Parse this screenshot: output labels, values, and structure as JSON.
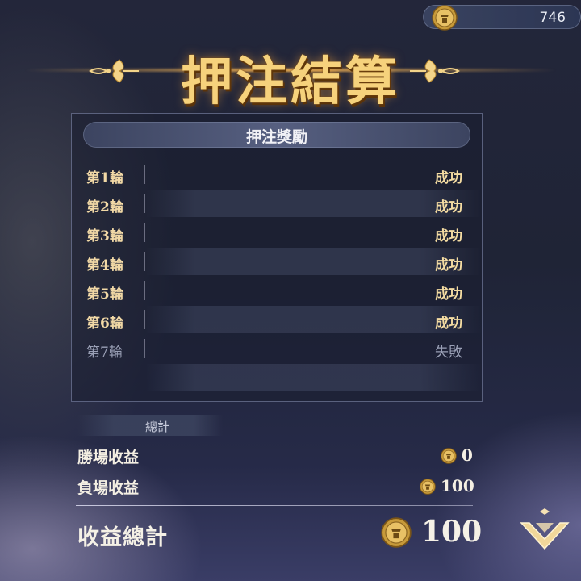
{
  "currency": {
    "amount": "746",
    "icon": "gold-coin-icon"
  },
  "title": "押注結算",
  "rewards": {
    "header": "押注獎勵",
    "rounds": [
      {
        "name": "第1輪",
        "result": "成功"
      },
      {
        "name": "第2輪",
        "result": "成功"
      },
      {
        "name": "第3輪",
        "result": "成功"
      },
      {
        "name": "第4輪",
        "result": "成功"
      },
      {
        "name": "第5輪",
        "result": "成功"
      },
      {
        "name": "第6輪",
        "result": "成功"
      },
      {
        "name": "第7輪",
        "result": "失敗"
      }
    ]
  },
  "totals": {
    "section_label": "總計",
    "win_label": "勝場收益",
    "win_value": "0",
    "lose_label": "負場收益",
    "lose_value": "100",
    "grand_label": "收益總計",
    "grand_value": "100"
  },
  "colors": {
    "gold": "#f6d27c",
    "success": "#f4dca2",
    "fail": "#9aa0b6",
    "panel_border": "#8c96b9"
  }
}
